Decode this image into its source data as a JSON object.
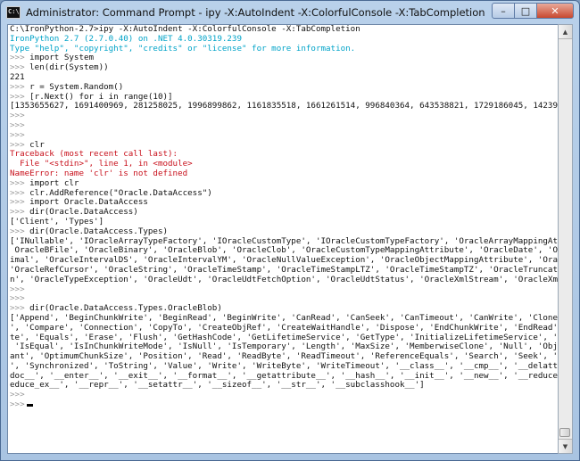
{
  "window": {
    "title": "Administrator: Command Prompt - ipy  -X:AutoIndent -X:ColorfulConsole -X:TabCompletion",
    "icon_text": "C:\\",
    "min_glyph": "–",
    "max_glyph": "□",
    "close_glyph": "✕"
  },
  "console": {
    "lines": [
      "C:\\IronPython-2.7>ipy -X:AutoIndent -X:ColorfulConsole -X:TabCompletion",
      "IronPython 2.7 (2.7.0.40) on .NET 4.0.30319.239",
      "Type \"help\", \"copyright\", \"credits\" or \"license\" for more information.",
      ">>> import System",
      ">>> len(dir(System))",
      "221",
      ">>> r = System.Random()",
      ">>> [r.Next() for i in range(10)]",
      "[1353655627, 1691400969, 281258025, 1996899862, 1161835518, 1661261514, 996840364, 643538821, 1729186045, 1423961983]",
      ">>>",
      ">>>",
      ">>>",
      ">>> clr",
      "Traceback (most recent call last):",
      "  File \"<stdin>\", line 1, in <module>",
      "NameError: name 'clr' is not defined",
      ">>> import clr",
      ">>> clr.AddReference(\"Oracle.DataAccess\")",
      ">>> import Oracle.DataAccess",
      ">>> dir(Oracle.DataAccess)",
      "['Client', 'Types']",
      ">>> dir(Oracle.DataAccess.Types)",
      "['INullable', 'IOracleArrayTypeFactory', 'IOracleCustomType', 'IOracleCustomTypeFactory', 'OracleArrayMappingAttribute', '",
      " OracleBFile', 'OracleBinary', 'OracleBlob', 'OracleClob', 'OracleCustomTypeMappingAttribute', 'OracleDate', 'OracleDec",
      "imal', 'OracleIntervalDS', 'OracleIntervalYM', 'OracleNullValueException', 'OracleObjectMappingAttribute', 'OracleRef',",
      "'OracleRefCursor', 'OracleString', 'OracleTimeStamp', 'OracleTimeStampLTZ', 'OracleTimeStampTZ', 'OracleTruncateExceptio",
      "n', 'OracleTypeException', 'OracleUdt', 'OracleUdtFetchOption', 'OracleUdtStatus', 'OracleXmlStream', 'OracleXmlType']",
      ">>>",
      ">>>",
      ">>> dir(Oracle.DataAccess.Types.OracleBlob)",
      "['Append', 'BeginChunkWrite', 'BeginRead', 'BeginWrite', 'CanRead', 'CanSeek', 'CanTimeout', 'CanWrite', 'Clone', 'Close",
      "', 'Compare', 'Connection', 'CopyTo', 'CreateObjRef', 'CreateWaitHandle', 'Dispose', 'EndChunkWrite', 'EndRead', 'EndWri",
      "te', 'Equals', 'Erase', 'Flush', 'GetHashCode', 'GetLifetimeService', 'GetType', 'InitializeLifetimeService', 'IsEmpty',",
      " 'IsEqual', 'IsInChunkWriteMode', 'IsNull', 'IsTemporary', 'Length', 'MaxSize', 'MemberwiseClone', 'Null', 'ObjectInvari",
      "ant', 'OptimumChunkSize', 'Position', 'Read', 'ReadByte', 'ReadTimeout', 'ReferenceEquals', 'Search', 'Seek', 'SetLength",
      "', 'Synchronized', 'ToString', 'Value', 'Write', 'WriteByte', 'WriteTimeout', '__class__', '__cmp__', '__delattr__', '__",
      "doc__', '__enter__', '__exit__', '__format__', '__getattribute__', '__hash__', '__init__', '__new__', '__reduce__', '__r",
      "educe_ex__', '__repr__', '__setattr__', '__sizeof__', '__str__', '__subclasshook__']",
      ">>>",
      ">>>"
    ],
    "line_colors": {
      "1": "cyan",
      "2": "cyan",
      "13": "red",
      "14": "red",
      "15": "red"
    }
  }
}
